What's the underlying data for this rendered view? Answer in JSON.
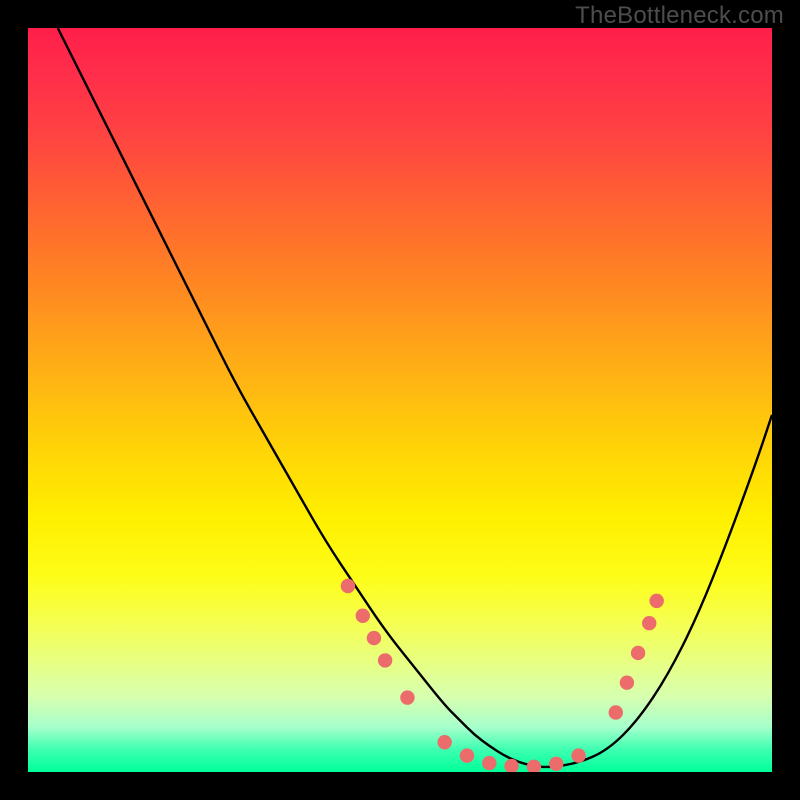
{
  "watermark": "TheBottleneck.com",
  "chart_data": {
    "type": "line",
    "title": "",
    "xlabel": "",
    "ylabel": "",
    "xlim": [
      0,
      100
    ],
    "ylim": [
      0,
      100
    ],
    "grid": false,
    "series": [
      {
        "name": "curve",
        "x": [
          4,
          8,
          12,
          16,
          20,
          24,
          28,
          32,
          36,
          40,
          44,
          48,
          52,
          56,
          58,
          60,
          62,
          64,
          66,
          68,
          70,
          74,
          78,
          82,
          86,
          90,
          94,
          98,
          100
        ],
        "y": [
          100,
          92,
          84,
          76,
          68,
          60,
          52,
          45,
          38,
          31,
          25,
          19,
          14,
          9,
          7,
          5,
          3.5,
          2.2,
          1.3,
          0.8,
          0.6,
          1.2,
          3,
          7,
          13,
          21,
          31,
          42,
          48
        ]
      }
    ],
    "markers": [
      {
        "x": 43,
        "y": 25
      },
      {
        "x": 45,
        "y": 21
      },
      {
        "x": 46.5,
        "y": 18
      },
      {
        "x": 48,
        "y": 15
      },
      {
        "x": 51,
        "y": 10
      },
      {
        "x": 56,
        "y": 4
      },
      {
        "x": 59,
        "y": 2.2
      },
      {
        "x": 62,
        "y": 1.2
      },
      {
        "x": 65,
        "y": 0.8
      },
      {
        "x": 68,
        "y": 0.7
      },
      {
        "x": 71,
        "y": 1.1
      },
      {
        "x": 74,
        "y": 2.2
      },
      {
        "x": 79,
        "y": 8
      },
      {
        "x": 80.5,
        "y": 12
      },
      {
        "x": 82,
        "y": 16
      },
      {
        "x": 83.5,
        "y": 20
      },
      {
        "x": 84.5,
        "y": 23
      }
    ],
    "colors": {
      "curve": "#000000",
      "marker": "#ec6b6b",
      "gradient_top": "#ff1f4a",
      "gradient_bottom": "#00ff9a"
    }
  }
}
